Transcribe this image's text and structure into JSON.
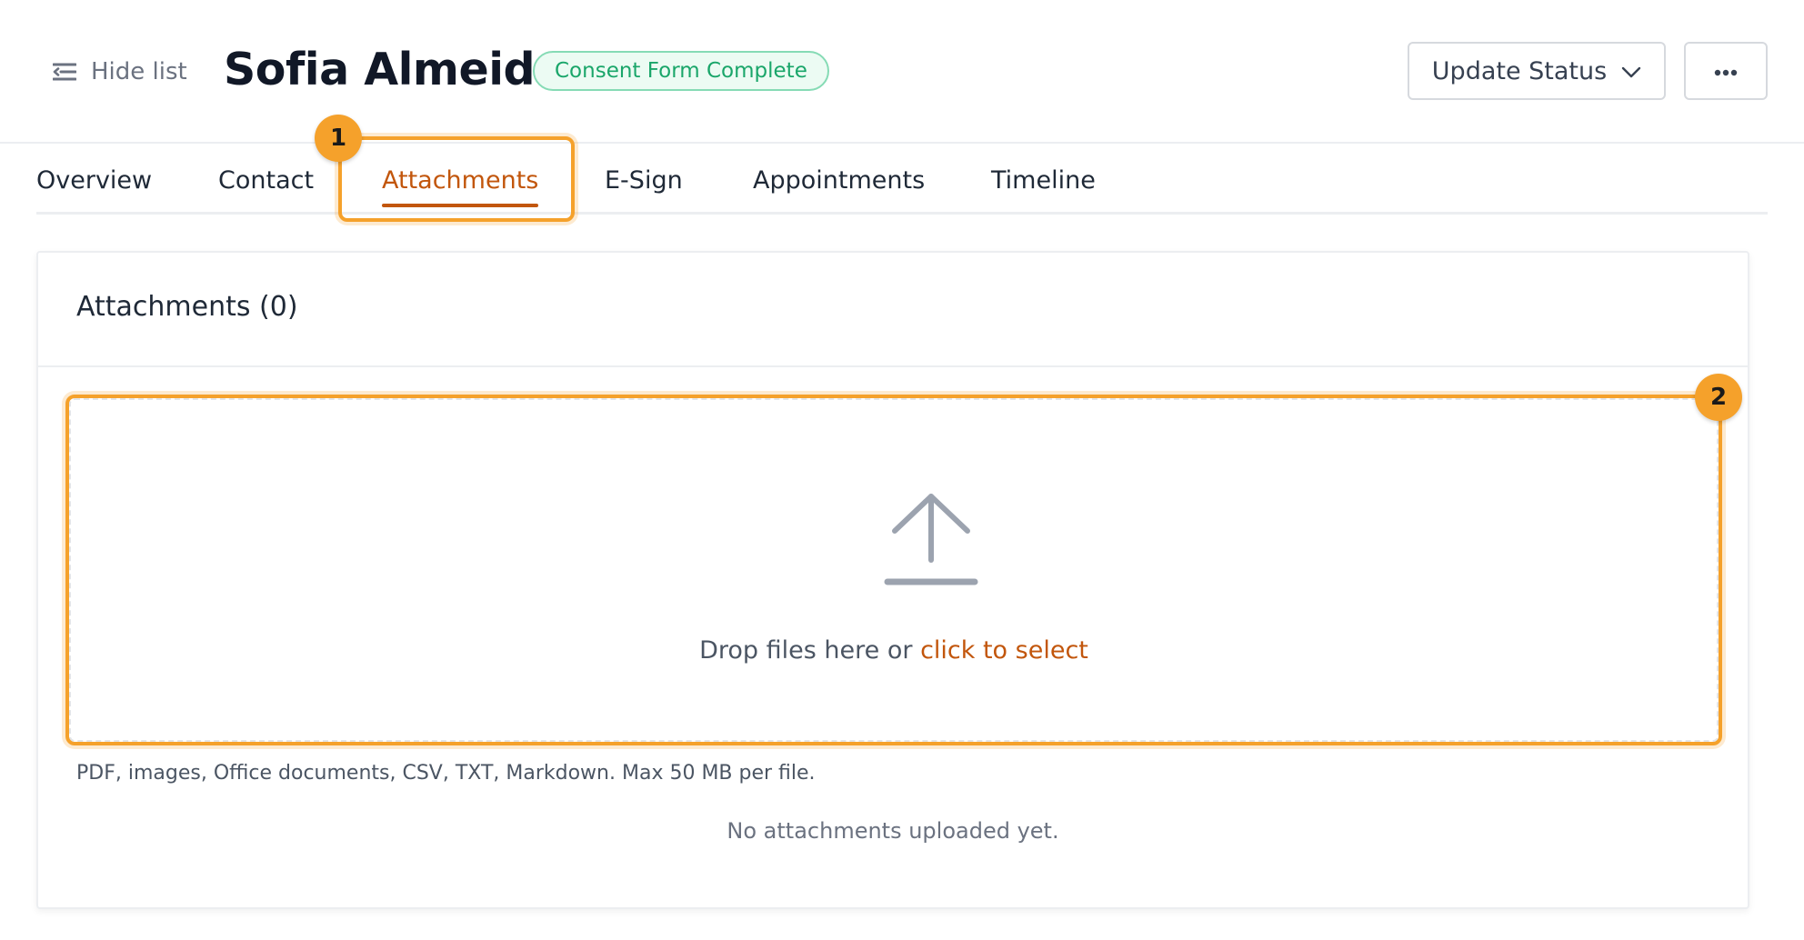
{
  "header": {
    "hide_list_label": "Hide list",
    "person_name": "Sofia Almeida",
    "status_badge": "Consent Form Complete",
    "update_status_label": "Update Status"
  },
  "tabs": [
    {
      "label": "Overview",
      "active": false
    },
    {
      "label": "Contact",
      "active": false
    },
    {
      "label": "Attachments",
      "active": true
    },
    {
      "label": "E-Sign",
      "active": false
    },
    {
      "label": "Appointments",
      "active": false
    },
    {
      "label": "Timeline",
      "active": false
    }
  ],
  "annotations": {
    "marker_1": "1",
    "marker_2": "2"
  },
  "attachments": {
    "title": "Attachments (0)",
    "drop_text": "Drop files here or",
    "drop_link": "click to select",
    "file_hint": "PDF, images, Office documents, CSV, TXT, Markdown. Max 50 MB per file.",
    "empty_message": "No attachments uploaded yet."
  },
  "icons": {
    "hide_list": "list-collapse-icon",
    "update_status_chevron": "chevron-down-icon",
    "more": "ellipsis-icon",
    "upload": "upload-arrow-icon"
  },
  "colors": {
    "accent": "#c2560c",
    "highlight": "#f5a12b",
    "badge_text": "#1aa66a",
    "badge_bg": "#ecfbf3"
  }
}
